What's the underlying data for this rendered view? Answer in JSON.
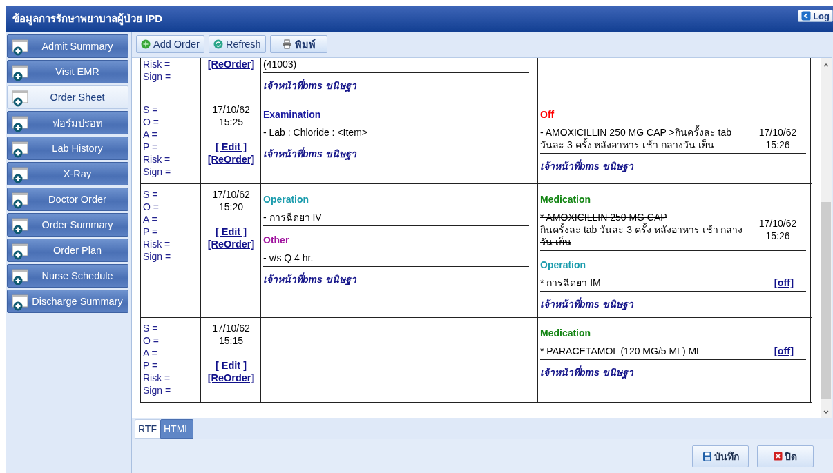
{
  "window": {
    "title": "ข้อมูลการรักษาพยาบาลผู้ป่วย IPD",
    "corner_button": "Log"
  },
  "sidebar": {
    "items": [
      {
        "label": "Admit Summary",
        "selected": false
      },
      {
        "label": "Visit EMR",
        "selected": false
      },
      {
        "label": "Order Sheet",
        "selected": true
      },
      {
        "label": "ฟอร์มปรอท",
        "selected": false
      },
      {
        "label": "Lab History",
        "selected": false
      },
      {
        "label": "X-Ray",
        "selected": false
      },
      {
        "label": "Doctor Order",
        "selected": false
      },
      {
        "label": "Order Summary",
        "selected": false
      },
      {
        "label": "Order Plan",
        "selected": false
      },
      {
        "label": "Nurse Schedule",
        "selected": false
      },
      {
        "label": "Discharge Summary",
        "selected": false
      }
    ]
  },
  "toolbar": [
    {
      "kind": "add",
      "label": "Add Order"
    },
    {
      "kind": "refresh",
      "label": "Refresh"
    },
    {
      "kind": "print",
      "label": "พิมพ์"
    }
  ],
  "orders": [
    {
      "soap": [
        "Risk =",
        "Sign ="
      ],
      "links": [
        "[ReOrder]"
      ],
      "left": {
        "sections": [
          {
            "items": [
              {
                "text": "(41003)",
                "struck": false
              }
            ]
          }
        ],
        "signer": "เจ้าหน้าที่bms ขนิษฐา"
      }
    },
    {
      "soap": [
        "S =",
        "O =",
        "A =",
        "P =",
        "Risk =",
        "Sign ="
      ],
      "date": "17/10/62",
      "time": "15:25",
      "links": [
        "[ Edit ]",
        "[ReOrder]"
      ],
      "left": {
        "sections": [
          {
            "kind": "examination",
            "title": "Examination",
            "items": [
              {
                "text": "- Lab : Chloride : <Item>",
                "struck": false
              }
            ]
          }
        ],
        "signer": "เจ้าหน้าที่bms ขนิษฐา"
      },
      "right": {
        "sections": [
          {
            "kind": "off",
            "title": "Off",
            "items": [
              {
                "text": "- AMOXICILLIN 250 MG CAP >กินครั้งละ   tab วันละ 3 ครั้ง หลังอาหาร เช้า กลางวัน เย็น",
                "struck": false,
                "date": "17/10/62",
                "time": "15:26"
              }
            ]
          }
        ],
        "signer": "เจ้าหน้าที่bms ขนิษฐา"
      }
    },
    {
      "soap": [
        "S =",
        "O =",
        "A =",
        "P =",
        "Risk =",
        "Sign ="
      ],
      "date": "17/10/62",
      "time": "15:20",
      "links": [
        "[ Edit ]",
        "[ReOrder]"
      ],
      "left": {
        "sections": [
          {
            "kind": "operation",
            "title": "Operation",
            "items": [
              {
                "text": "- การฉีดยา IV",
                "struck": false
              }
            ]
          },
          {
            "kind": "other",
            "title": "Other",
            "items": [
              {
                "text": "- v/s Q 4 hr.",
                "struck": false
              }
            ]
          }
        ],
        "signer": "เจ้าหน้าที่bms ขนิษฐา"
      },
      "right": {
        "sections": [
          {
            "kind": "medication",
            "title": "Medication",
            "items": [
              {
                "text": "* AMOXICILLIN 250 MG CAP\n กินครั้งละ   tab วันละ 3 ครั้ง หลังอาหาร เช้า กลางวัน เย็น",
                "struck": true,
                "date": "17/10/62",
                "time": "15:26"
              }
            ]
          },
          {
            "kind": "operation",
            "title": "Operation",
            "items": [
              {
                "text": "* การฉีดยา IM",
                "struck": false,
                "action": "[off]"
              }
            ]
          }
        ],
        "signer": "เจ้าหน้าที่bms ขนิษฐา"
      }
    },
    {
      "soap": [
        "S =",
        "O =",
        "A =",
        "P =",
        "Risk =",
        "Sign ="
      ],
      "date": "17/10/62",
      "time": "15:15",
      "links": [
        "[ Edit ]",
        "[ReOrder]"
      ],
      "right": {
        "sections": [
          {
            "kind": "medication",
            "title": "Medication",
            "items": [
              {
                "text": "* PARACETAMOL (120 MG/5 ML) ML",
                "struck": false,
                "action": "[off]"
              }
            ]
          }
        ],
        "signer": "เจ้าหน้าที่bms ขนิษฐา"
      }
    }
  ],
  "view_tabs": [
    {
      "label": "RTF",
      "selected": true
    },
    {
      "label": "HTML",
      "selected": false
    }
  ],
  "footer_buttons": [
    {
      "kind": "save",
      "label": "บันทึก"
    },
    {
      "kind": "close",
      "label": "ปิด"
    }
  ]
}
